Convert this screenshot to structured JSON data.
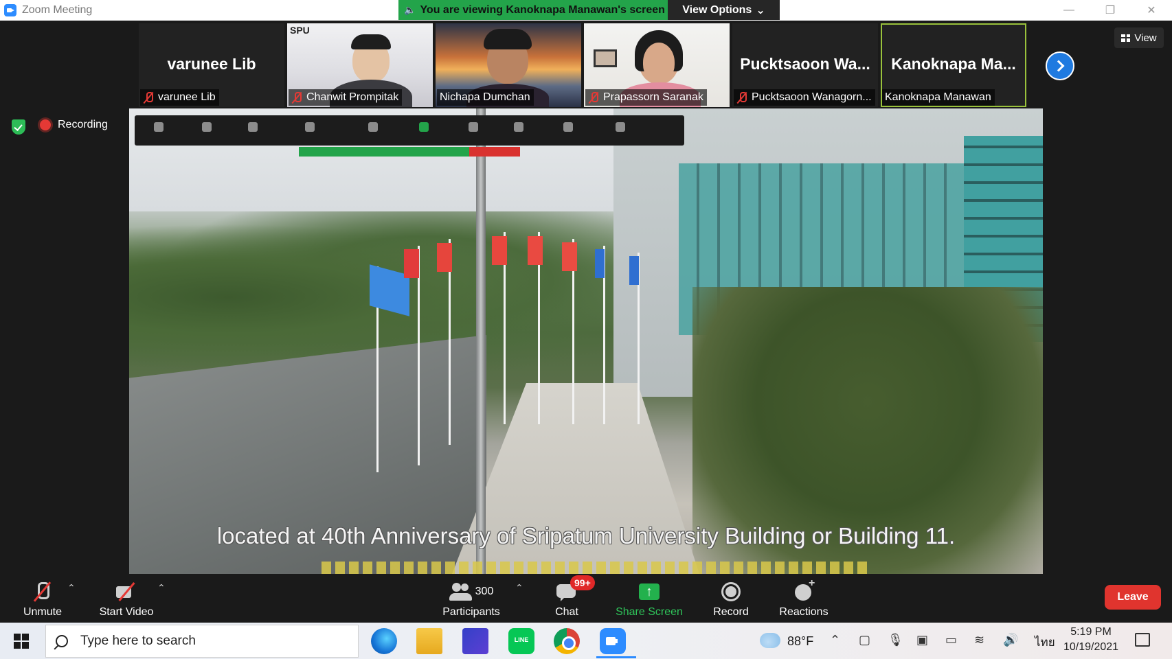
{
  "window": {
    "title": "Zoom Meeting",
    "viewing_banner": "You are viewing Kanoknapa Manawan's screen",
    "view_options_label": "View Options"
  },
  "participants": [
    {
      "big_name": "varunee Lib",
      "label": "varunee Lib",
      "muted": true
    },
    {
      "big_name": "",
      "label": "Chanwit Prompitak",
      "muted": true
    },
    {
      "big_name": "",
      "label": "Nichapa Dumchan",
      "muted": false
    },
    {
      "big_name": "",
      "label": "Prapassorn Saranak",
      "muted": true
    },
    {
      "big_name": "Pucktsaoon  Wa...",
      "label": "Pucktsaoon Wanagorn...",
      "muted": true
    },
    {
      "big_name": "Kanoknapa  Ma...",
      "label": "Kanoknapa Manawan",
      "muted": false
    }
  ],
  "tile_logo_text": "SPU",
  "view_button_label": "View",
  "recording_label": "Recording",
  "shared_screen": {
    "subtitle": "located at 40th Anniversary of Sripatum University Building or Building 11."
  },
  "toolbar": {
    "unmute_label": "Unmute",
    "start_video_label": "Start Video",
    "participants_label": "Participants",
    "participants_count": "300",
    "chat_label": "Chat",
    "chat_badge": "99+",
    "share_screen_label": "Share Screen",
    "record_label": "Record",
    "reactions_label": "Reactions",
    "leave_label": "Leave"
  },
  "taskbar": {
    "search_placeholder": "Type here to search",
    "temperature": "88°F",
    "language": "ไทย",
    "time": "5:19 PM",
    "date": "10/19/2021"
  },
  "colors": {
    "zoom_blue": "#2d8cff",
    "banner_green": "#23a44a",
    "leave_red": "#e0342e",
    "active_border": "#9ac23c"
  }
}
